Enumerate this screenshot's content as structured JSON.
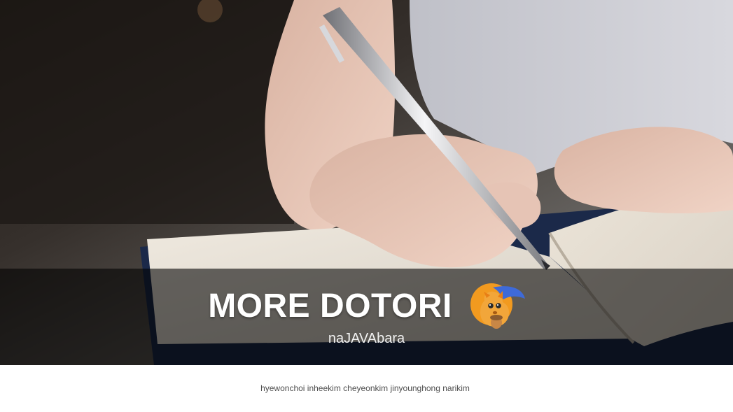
{
  "hero": {
    "title": "MORE DOTORI",
    "team_name": "naJAVAbara",
    "mascot_icon": "squirrel-mascot-icon"
  },
  "footer": {
    "members": "hyewonchoi inheekim cheyeonkim jinyounghong narikim"
  },
  "colors": {
    "overlay": "#000000",
    "title": "#ffffff",
    "footer_text": "#4e4e4e",
    "mascot_orange": "#f29a1f",
    "mascot_blue": "#3e6ad8"
  }
}
